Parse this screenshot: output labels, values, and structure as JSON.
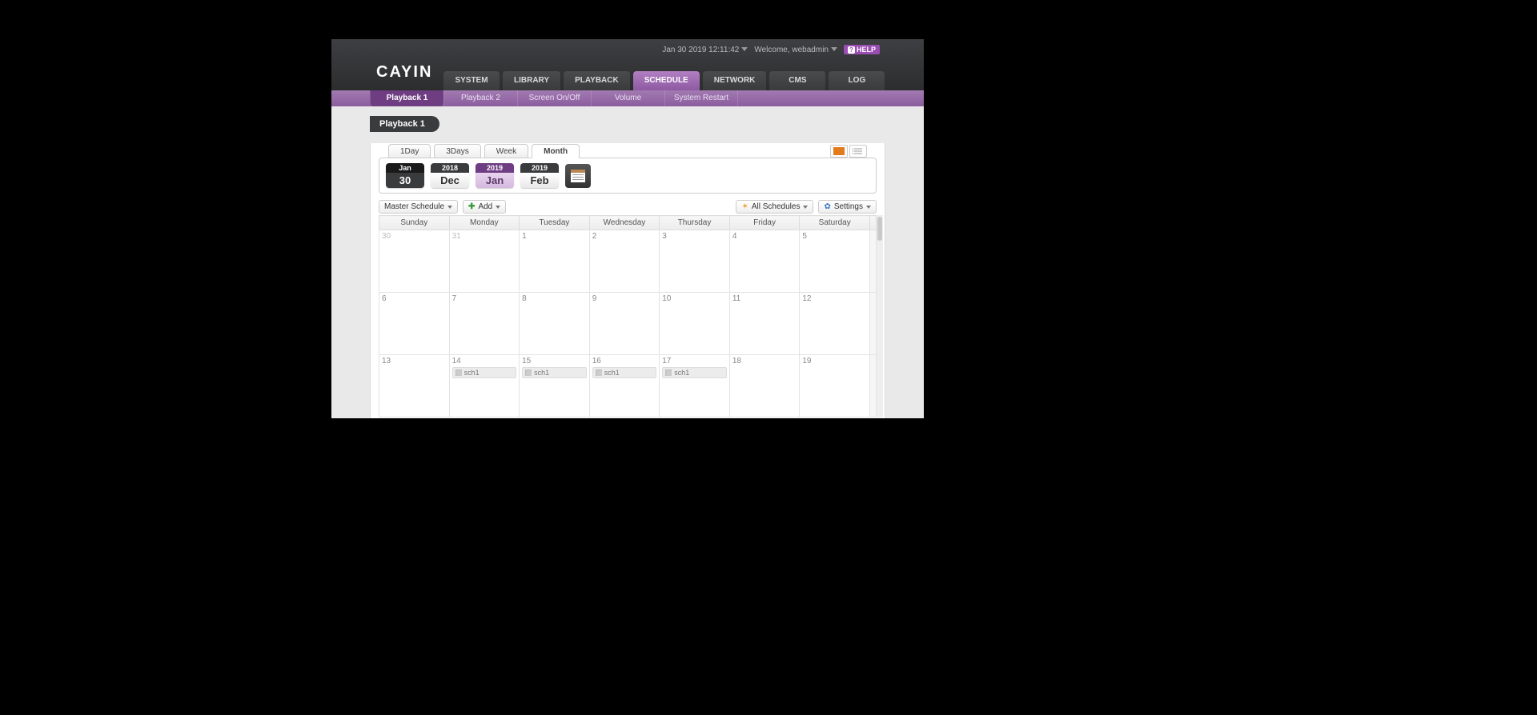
{
  "header": {
    "datetime": "Jan 30 2019 12:11:42",
    "welcome": "Welcome, webadmin",
    "help": "HELP",
    "logo": "CAYIN"
  },
  "mainnav": [
    {
      "label": "SYSTEM",
      "active": false
    },
    {
      "label": "LIBRARY",
      "active": false
    },
    {
      "label": "PLAYBACK",
      "active": false
    },
    {
      "label": "SCHEDULE",
      "active": true
    },
    {
      "label": "NETWORK",
      "active": false
    },
    {
      "label": "CMS",
      "active": false
    },
    {
      "label": "LOG",
      "active": false
    }
  ],
  "subnav": [
    {
      "label": "Playback 1",
      "active": true
    },
    {
      "label": "Playback 2",
      "active": false
    },
    {
      "label": "Screen On/Off",
      "active": false
    },
    {
      "label": "Volume",
      "active": false
    },
    {
      "label": "System Restart",
      "active": false
    }
  ],
  "page_title": "Playback 1",
  "view_tabs": [
    {
      "label": "1Day",
      "active": false
    },
    {
      "label": "3Days",
      "active": false
    },
    {
      "label": "Week",
      "active": false
    },
    {
      "label": "Month",
      "active": true
    }
  ],
  "date_nav": {
    "today": {
      "top": "Jan",
      "bot": "30"
    },
    "prev": {
      "top": "2018",
      "bot": "Dec"
    },
    "curr": {
      "top": "2019",
      "bot": "Jan"
    },
    "next": {
      "top": "2019",
      "bot": "Feb"
    }
  },
  "toolbar": {
    "master": "Master Schedule",
    "add": "Add",
    "all": "All Schedules",
    "settings": "Settings"
  },
  "calendar": {
    "days": [
      "Sunday",
      "Monday",
      "Tuesday",
      "Wednesday",
      "Thursday",
      "Friday",
      "Saturday"
    ],
    "weeks": [
      [
        {
          "n": "30",
          "off": true
        },
        {
          "n": "31",
          "off": true
        },
        {
          "n": "1"
        },
        {
          "n": "2"
        },
        {
          "n": "3"
        },
        {
          "n": "4"
        },
        {
          "n": "5"
        }
      ],
      [
        {
          "n": "6"
        },
        {
          "n": "7"
        },
        {
          "n": "8"
        },
        {
          "n": "9"
        },
        {
          "n": "10"
        },
        {
          "n": "11"
        },
        {
          "n": "12"
        }
      ],
      [
        {
          "n": "13"
        },
        {
          "n": "14",
          "ev": "sch1"
        },
        {
          "n": "15",
          "ev": "sch1"
        },
        {
          "n": "16",
          "ev": "sch1"
        },
        {
          "n": "17",
          "ev": "sch1"
        },
        {
          "n": "18"
        },
        {
          "n": "19"
        }
      ]
    ]
  }
}
